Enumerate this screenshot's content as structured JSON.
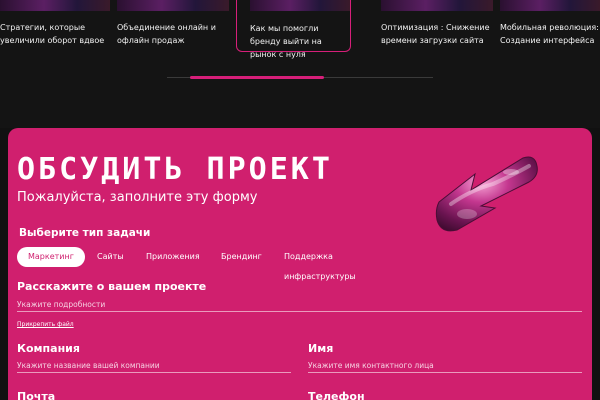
{
  "cases": [
    {
      "title": "Стратегии, которые увеличили оборот вдвое"
    },
    {
      "title": "Объединение онлайн и офлайн продаж"
    },
    {
      "title": "Как мы помогли бренду выйти на рынок с нуля"
    },
    {
      "title": "Оптимизация : Снижение времени загрузки сайта"
    },
    {
      "title": "Мобильная революция: Создание интерфейса"
    }
  ],
  "form": {
    "headline": "ОБСУДИТЬ ПРОЕКТ",
    "subtitle": "Пожалуйста, заполните эту форму",
    "task_type_label": "Выберите тип задачи",
    "task_types": [
      "Маркетинг",
      "Сайты",
      "Приложения",
      "Брендинг",
      "Поддержка инфраструктуры"
    ],
    "active_task_type": "Маркетинг",
    "project_label": "Расскажите о вашем проекте",
    "project_placeholder": "Укажите подробности",
    "attach_label": "Прикрепить файл",
    "company_label": "Компания",
    "company_placeholder": "Укажите название вашей компании",
    "name_label": "Имя",
    "name_placeholder": "Укажите имя контактного лица",
    "email_label": "Почта",
    "phone_label": "Телефон"
  },
  "colors": {
    "accent": "#d01f6e",
    "background": "#111111"
  }
}
